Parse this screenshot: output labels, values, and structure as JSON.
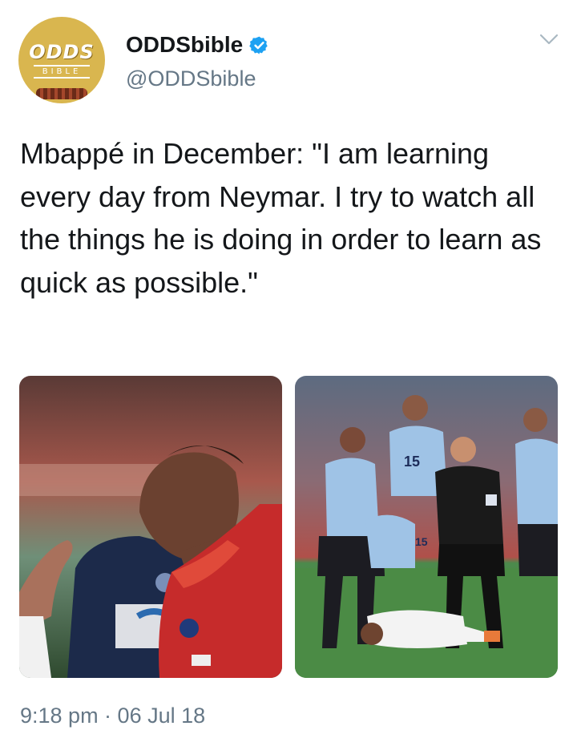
{
  "account": {
    "display_name": "ODDSbible",
    "handle": "@ODDSbible",
    "avatar_logo_top": "ODDS",
    "avatar_logo_bottom": "BIBLE",
    "verified": true
  },
  "tweet": {
    "text": "Mbappé in December: \"I am learning every day from Neymar. I try to watch all the things he is doing in order to learn as quick as possible.\"",
    "timestamp": "9:18 pm · 06 Jul 18"
  },
  "media": {
    "left_shirt_number": "",
    "right_shirt_number": "15",
    "right_shirt_number_2": "15"
  },
  "icons": {
    "verified": "verified-badge-icon",
    "menu": "chevron-down-icon"
  },
  "colors": {
    "text": "#14171a",
    "secondary_text": "#657786",
    "verified_blue": "#1da1f2",
    "avatar_gold": "#d9b64f"
  }
}
